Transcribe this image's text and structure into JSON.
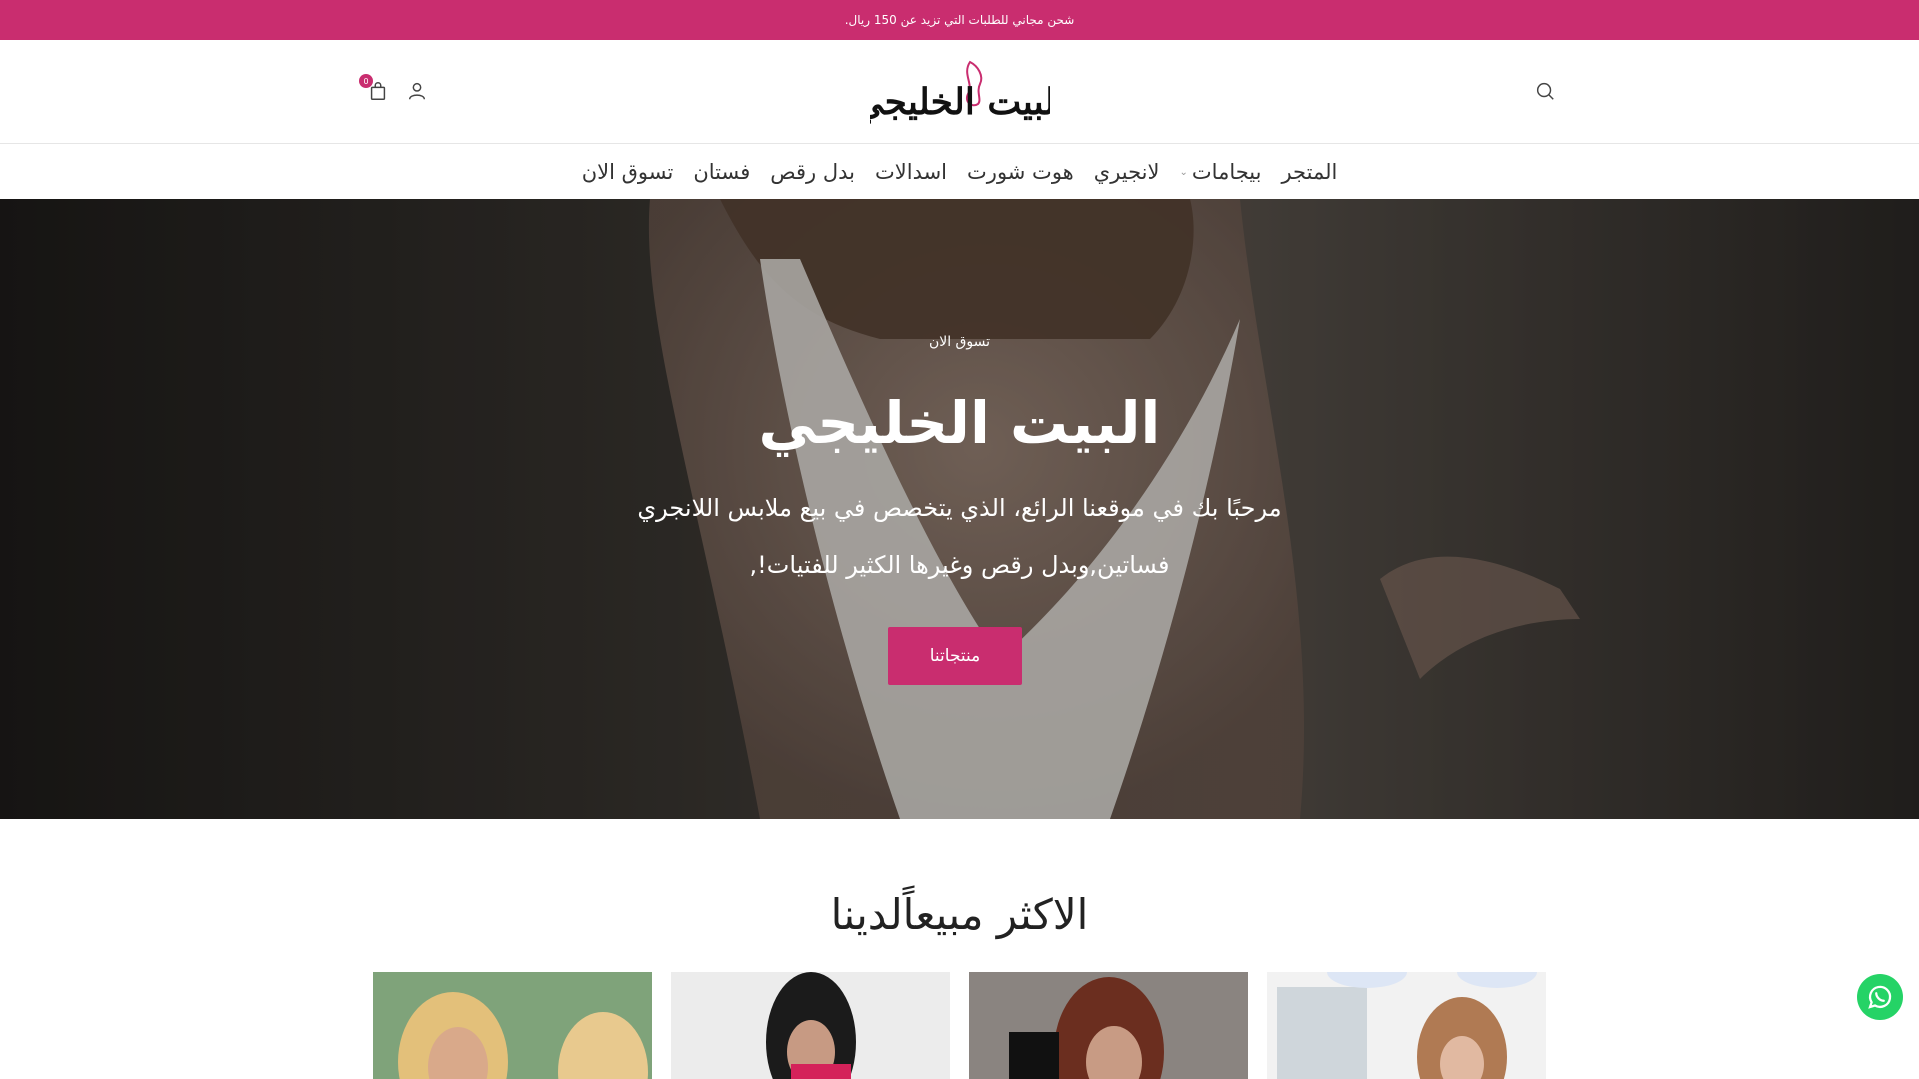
{
  "promo": {
    "text": "شحن مجاني للطلبات التي تزيد عن 150 ريال."
  },
  "header": {
    "logo_text": "البيت الخليجي",
    "cart_count": "0"
  },
  "nav": {
    "items": [
      {
        "label": "المتجر"
      },
      {
        "label": "بيجامات",
        "has_dropdown": true
      },
      {
        "label": "لانجيري"
      },
      {
        "label": "هوت شورت"
      },
      {
        "label": "اسدالات"
      },
      {
        "label": "بدل رقص"
      },
      {
        "label": "فستان"
      },
      {
        "label": "تسوق الان"
      }
    ]
  },
  "hero": {
    "kicker": "تسوق الان",
    "title": "البيت الخليجي",
    "line1": "مرحبًا بك في موقعنا الرائع، الذي يتخصص في بيع ملابس اللانجري",
    "line2": "فساتين,وبدل رقص وغيرها الكثير للفتيات!,",
    "button": "منتجاتنا"
  },
  "bestsellers": {
    "title": "الاكثر مبيعاًلدينا"
  },
  "colors": {
    "accent": "#c92d6f",
    "whatsapp": "#25d366"
  },
  "icons": [
    "search-icon",
    "user-icon",
    "shopping-bag-icon",
    "chevron-down-icon",
    "whatsapp-icon"
  ]
}
